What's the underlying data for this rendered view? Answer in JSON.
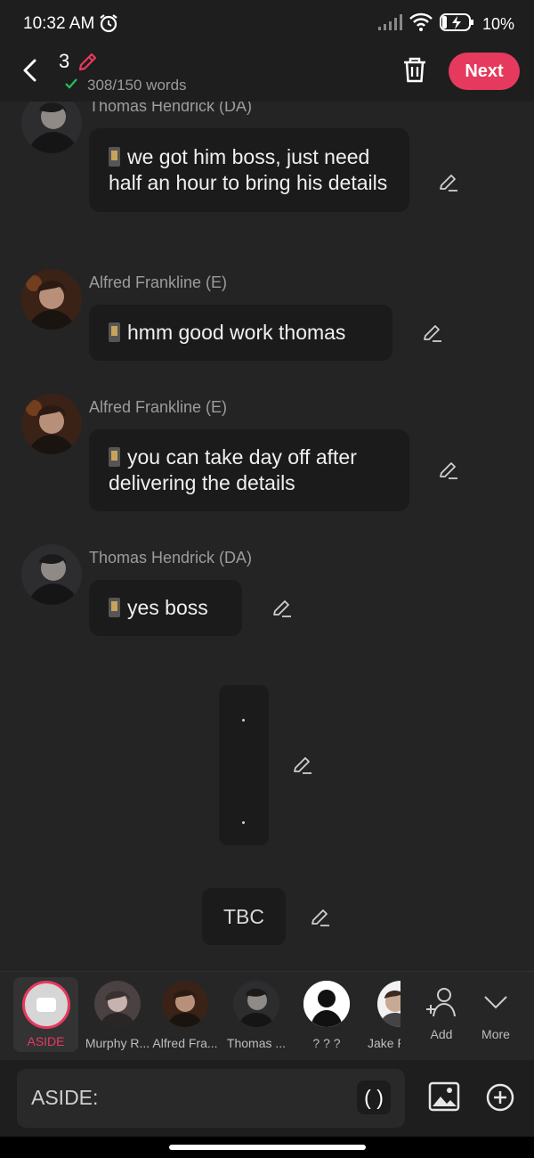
{
  "status": {
    "time": "10:32 AM",
    "battery": "10%"
  },
  "header": {
    "chapter": "3",
    "word_count": "308/150 words",
    "next_label": "Next"
  },
  "messages": [
    {
      "speaker": "Thomas Hendrick (DA)",
      "text": "we got him boss, just need half an hour to bring his details"
    },
    {
      "speaker": "Alfred Frankline (E)",
      "text": "hmm good work thomas"
    },
    {
      "speaker": "Alfred Frankline (E)",
      "text": "you can take day off after delivering the details"
    },
    {
      "speaker": "Thomas Hendrick (DA)",
      "text": "yes boss"
    }
  ],
  "narration": {
    "top_dot": ".",
    "bottom_dot": "."
  },
  "tbc": "TBC",
  "characters": {
    "aside": "ASIDE",
    "items": [
      "Murphy R...",
      "Alfred Fra...",
      "Thomas ...",
      "? ? ?",
      "Jake F"
    ],
    "add": "Add",
    "more": "More"
  },
  "input": {
    "label": "ASIDE:",
    "paren": "( )"
  },
  "colors": {
    "accent": "#e53a5d",
    "bubble": "#1b1b1b",
    "background": "#242424"
  }
}
